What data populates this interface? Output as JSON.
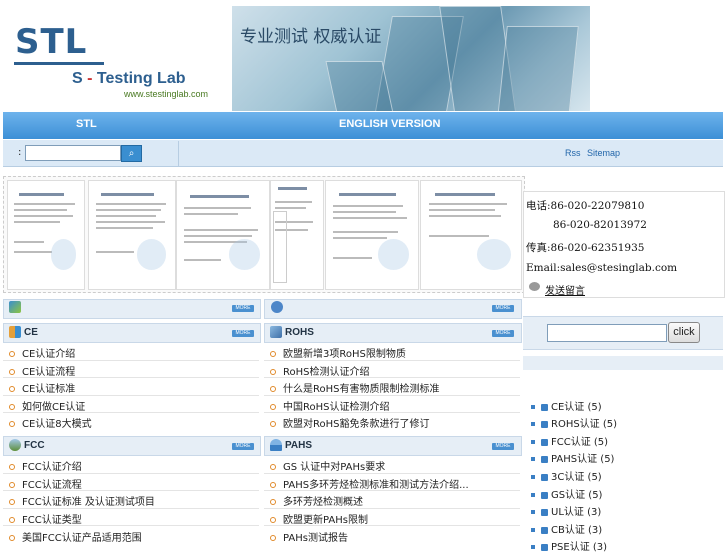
{
  "header": {
    "logo_text": "STL",
    "logo_subtitle_left": "S",
    "logo_subtitle_dash": " - ",
    "logo_subtitle_right": "Testing Lab",
    "logo_url": "www.stestinglab.com",
    "banner_slogan": "专业测试 权威认证"
  },
  "nav": {
    "home_label": "STL",
    "english_label": "ENGLISH VERSION"
  },
  "searchbar": {
    "prefix": ":",
    "input_value": "",
    "go_icon": "search-icon",
    "rss_label": "Rss",
    "sitemap_label": "Sitemap"
  },
  "certificates": {
    "items": [
      "certificate-1",
      "certificate-2",
      "certificate-3",
      "certificate-4",
      "certificate-5"
    ]
  },
  "contact": {
    "phone1": "电话:86-020-22079810",
    "phone2": "86-020-82013972",
    "fax": "传真:86-020-62351935",
    "email": "Email:sales@stesinglab.com",
    "message_label": "发送留言"
  },
  "right_search": {
    "input_value": "",
    "button_label": "click"
  },
  "categories": [
    {
      "label": "CE认证",
      "count": "(5)"
    },
    {
      "label": "ROHS认证",
      "count": "(5)"
    },
    {
      "label": "FCC认证",
      "count": "(5)"
    },
    {
      "label": "PAHS认证",
      "count": "(5)"
    },
    {
      "label": "3C认证",
      "count": "(5)"
    },
    {
      "label": "GS认证",
      "count": "(5)"
    },
    {
      "label": "UL认证",
      "count": "(3)"
    },
    {
      "label": "CB认证",
      "count": "(3)"
    },
    {
      "label": "PSE认证",
      "count": "(3)"
    }
  ],
  "panels": {
    "more_label": "MORE",
    "ce": {
      "title": "CE",
      "items": [
        "CE认证介绍",
        "CE认证流程",
        "CE认证标准",
        "如何做CE认证",
        "CE认证8大模式"
      ]
    },
    "rohs": {
      "title": "ROHS",
      "items": [
        "欧盟新增3项RoHS限制物质",
        "RoHS检测认证介绍",
        "什么是RoHS有害物质限制检测标准",
        "中国RoHS认证检测介绍",
        "欧盟对RoHS豁免条款进行了修订"
      ]
    },
    "fcc": {
      "title": "FCC",
      "items": [
        "FCC认证介绍",
        "FCC认证流程",
        "FCC认证标准 及认证测试项目",
        "FCC认证类型",
        "美国FCC认证产品适用范围"
      ]
    },
    "pahs": {
      "title": "PAHS",
      "items": [
        "GS 认证中对PAHs要求",
        "PAHS多环芳烃检测标准和测试方法介绍...",
        "多环芳烃检测概述",
        "欧盟更新PAHs限制",
        "PAHs测试报告"
      ]
    }
  },
  "colors": {
    "nav_blue": "#3c8fd6",
    "panel_header": "#e6eef6",
    "bullet_orange": "#e08a2a",
    "link_blue": "#2266aa"
  }
}
